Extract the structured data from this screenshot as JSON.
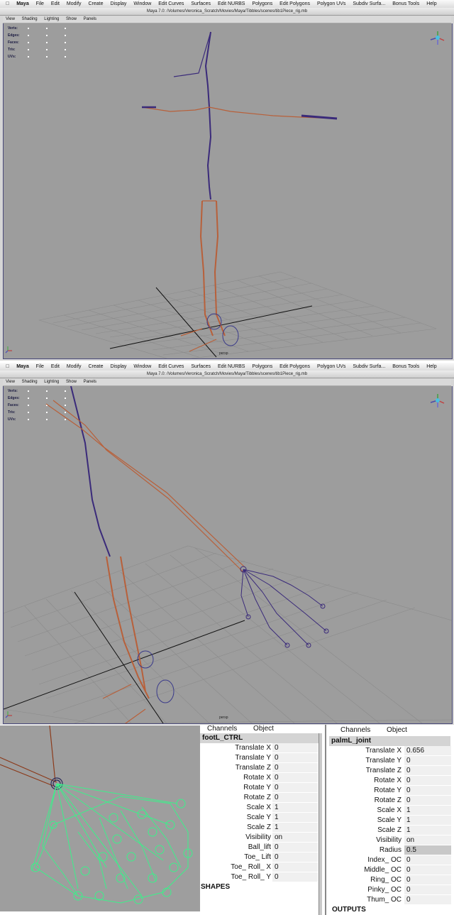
{
  "menubar": {
    "items": [
      "Maya",
      "File",
      "Edit",
      "Modify",
      "Create",
      "Display",
      "Window",
      "Edit Curves",
      "Surfaces",
      "Edit NURBS",
      "Polygons",
      "Edit Polygons",
      "Polygon UVs",
      "Subdiv Surfa...",
      "Bonus Tools",
      "Help"
    ]
  },
  "window": {
    "title": "Maya 7.0:  /Volumes/Veronica_Scratch/Movies/Maya/Tibbles/scenes/tib1Piece_rig.mb"
  },
  "panel_menu": [
    "View",
    "Shading",
    "Lighting",
    "Show",
    "Panels"
  ],
  "hud": [
    "Verts:",
    "Edges:",
    "Faces:",
    "Tris:",
    "UVs:"
  ],
  "viewport": {
    "camera_label": "persp",
    "axis_x": "x",
    "axis_y": "y",
    "axis_z": "z"
  },
  "channel_box_left": {
    "tabs": [
      "Channels",
      "Object"
    ],
    "node": "footL_CTRL",
    "rows": [
      {
        "label": "Translate X",
        "value": "0"
      },
      {
        "label": "Translate Y",
        "value": "0"
      },
      {
        "label": "Translate Z",
        "value": "0"
      },
      {
        "label": "Rotate X",
        "value": "0"
      },
      {
        "label": "Rotate Y",
        "value": "0"
      },
      {
        "label": "Rotate Z",
        "value": "0"
      },
      {
        "label": "Scale X",
        "value": "1"
      },
      {
        "label": "Scale Y",
        "value": "1"
      },
      {
        "label": "Scale Z",
        "value": "1"
      },
      {
        "label": "Visibility",
        "value": "on"
      },
      {
        "label": "Ball_lift",
        "value": "0"
      },
      {
        "label": "Toe_ Lift",
        "value": "0"
      },
      {
        "label": "Toe_ Roll_ X",
        "value": "0"
      },
      {
        "label": "Toe_ Roll_ Y",
        "value": "0"
      }
    ],
    "section": "SHAPES"
  },
  "channel_box_right": {
    "tabs": [
      "Channels",
      "Object"
    ],
    "node": "palmL_joint",
    "rows": [
      {
        "label": "Translate X",
        "value": "0.656"
      },
      {
        "label": "Translate Y",
        "value": "0"
      },
      {
        "label": "Translate Z",
        "value": "0"
      },
      {
        "label": "Rotate X",
        "value": "0"
      },
      {
        "label": "Rotate Y",
        "value": "0"
      },
      {
        "label": "Rotate Z",
        "value": "0"
      },
      {
        "label": "Scale X",
        "value": "1"
      },
      {
        "label": "Scale Y",
        "value": "1"
      },
      {
        "label": "Scale Z",
        "value": "1"
      },
      {
        "label": "Visibility",
        "value": "on"
      },
      {
        "label": "Radius",
        "value": "0.5"
      },
      {
        "label": "Index_ OC",
        "value": "0"
      },
      {
        "label": "Middle_ OC",
        "value": "0"
      },
      {
        "label": "Ring_ OC",
        "value": "0"
      },
      {
        "label": "Pinky_ OC",
        "value": "0"
      },
      {
        "label": "Thum_ OC",
        "value": "0"
      }
    ],
    "section": "OUTPUTS"
  },
  "colors": {
    "joint_blue": "#3a2a7a",
    "joint_orange": "#b8603a",
    "grid": "#8a8a8a",
    "viewport_bg": "#9d9d9d",
    "wire_green": "#3cf08a"
  }
}
